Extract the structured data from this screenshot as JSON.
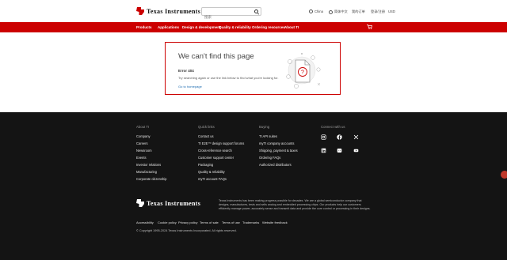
{
  "header": {
    "logo_text": "Texas Instruments",
    "search_placeholder": "搜索",
    "country": "China",
    "language": "简体中文",
    "account": "我的订单",
    "cart": "登录/注册",
    "currency": "USD"
  },
  "nav": {
    "items": [
      "Products",
      "Applications",
      "Design & development",
      "Quality & reliability",
      "Ordering resources",
      "About TI"
    ],
    "cart_icon": "cart-icon"
  },
  "error": {
    "title": "We can't find this page",
    "code": "Error 404",
    "message": "Try searching again or use the link below to find what you're looking for.",
    "link": "Go to homepage",
    "illustration_glyph": "?"
  },
  "footer": {
    "columns": [
      {
        "heading": "About TI",
        "links": [
          "Company",
          "Careers",
          "Newsroom",
          "Events",
          "Investor relations",
          "Manufacturing",
          "Corporate citizenship"
        ]
      },
      {
        "heading": "Quick links",
        "links": [
          "Contact us",
          "TI E2E™ design support forums",
          "Cross-reference search",
          "Customer support center",
          "Packaging",
          "Quality & reliability",
          "myTI account FAQs"
        ]
      },
      {
        "heading": "Buying",
        "links": [
          "TI API suites",
          "myTI company accounts",
          "Shipping, payment & taxes",
          "Ordering FAQs",
          "Authorized distributors"
        ]
      },
      {
        "heading": "Connect with us",
        "links": []
      }
    ],
    "social": [
      "instagram-icon",
      "facebook-icon",
      "x-icon",
      "linkedin-icon",
      "wechat-icon",
      "youtube-icon"
    ],
    "logo_text": "Texas Instruments",
    "about": "Texas Instruments has been making progress possible for decades. We are a global semiconductor company that designs, manufactures, tests and sells analog and embedded processing chips. Our products help our customers efficiently manage power, accurately sense and transmit data and provide the core control or processing in their designs.",
    "legal": [
      "Accessibility",
      "Cookie policy",
      "Privacy policy",
      "Terms of sale",
      "Terms of use",
      "Trademarks",
      "Website feedback"
    ],
    "copyright": "© Copyright 1995-2024 Texas Instruments Incorporated. All rights reserved."
  },
  "colors": {
    "brand_red": "#cc0000",
    "footer_bg": "#141414",
    "link_blue": "#1c6bb0"
  }
}
